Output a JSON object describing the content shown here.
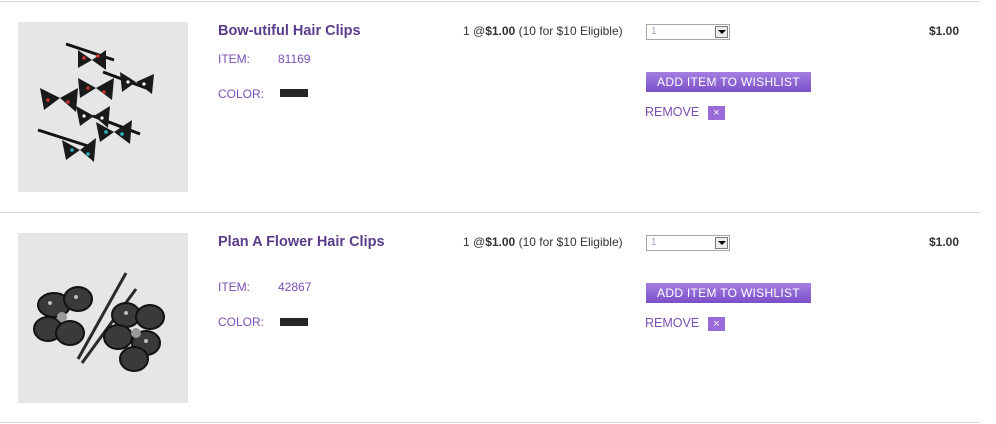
{
  "items": [
    {
      "image_alt": "bow hair clips",
      "title": "Bow-utiful Hair Clips",
      "item_label": "ITEM:",
      "item_number": "81169",
      "color_label": "COLOR:",
      "color_swatch": "#262626",
      "qty_prefix": "1 @",
      "price": "$1.00",
      "deal": "(10 for $10 Eligible)",
      "qty_selected": "1",
      "wishlist_label": "ADD ITEM TO WISHLIST",
      "remove_label": "REMOVE",
      "remove_icon": "×",
      "total": "$1.00"
    },
    {
      "image_alt": "flower hair clips",
      "title": "Plan A Flower Hair Clips",
      "item_label": "ITEM:",
      "item_number": "42867",
      "color_label": "COLOR:",
      "color_swatch": "#262626",
      "qty_prefix": "1 @",
      "price": "$1.00",
      "deal": "(10 for $10 Eligible)",
      "qty_selected": "1",
      "wishlist_label": "ADD ITEM TO WISHLIST",
      "remove_label": "REMOVE",
      "remove_icon": "×",
      "total": "$1.00"
    }
  ],
  "colors": {
    "accent": "#7b4fb3",
    "title": "#5a3d8a",
    "button": "#8a5fd0"
  }
}
